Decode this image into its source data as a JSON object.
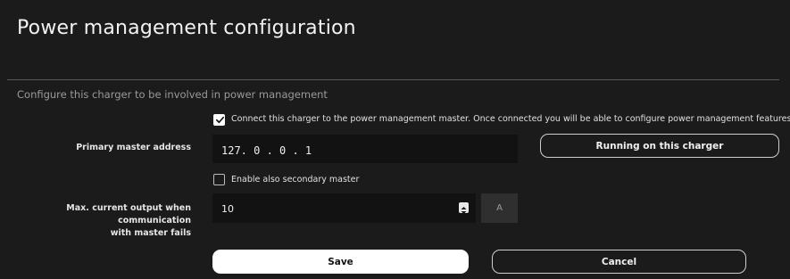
{
  "header": {
    "title": "Power management configuration"
  },
  "section": {
    "description": "Configure this charger to be involved in power management"
  },
  "connect_checkbox": {
    "checked": true,
    "label": "Connect this charger to the power management master. Once connected you will be able to configure power management features."
  },
  "primary_master": {
    "label": "Primary master address",
    "value": "127. 0 . 0 . 1",
    "running_button_label": "Running on this charger"
  },
  "secondary_master_checkbox": {
    "checked": false,
    "label": "Enable also secondary master"
  },
  "max_current": {
    "label_line1": "Max. current output when communication",
    "label_line2": "with master fails",
    "value": "10",
    "unit": "A"
  },
  "actions": {
    "save_label": "Save",
    "cancel_label": "Cancel"
  },
  "colors": {
    "background": "#1b1b1b",
    "input_background": "#121212",
    "primary_button": "#ffffff",
    "divider": "#5a5a5a"
  }
}
